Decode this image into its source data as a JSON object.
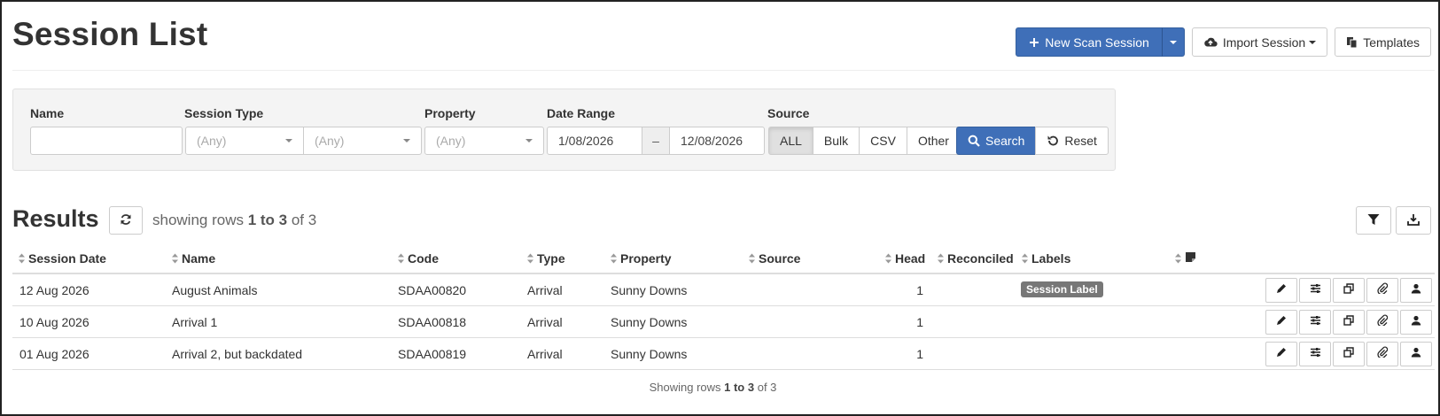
{
  "page": {
    "title": "Session List"
  },
  "header": {
    "new_session_label": "New Scan Session",
    "import_label": "Import Session",
    "templates_label": "Templates"
  },
  "filters": {
    "name_label": "Name",
    "name_value": "",
    "session_type_label": "Session Type",
    "session_type_value": "(Any)",
    "session_subtype_value": "(Any)",
    "property_label": "Property",
    "property_value": "(Any)",
    "date_range_label": "Date Range",
    "date_from": "1/08/2026",
    "date_separator": "–",
    "date_to": "12/08/2026",
    "source_label": "Source",
    "source_options": [
      "ALL",
      "Bulk",
      "CSV",
      "Other"
    ],
    "source_active": "ALL",
    "search_label": "Search",
    "reset_label": "Reset"
  },
  "results": {
    "title": "Results",
    "showing_prefix": "showing rows ",
    "showing_range": "1 to 3",
    "showing_suffix": " of 3",
    "columns": [
      "Session Date",
      "Name",
      "Code",
      "Type",
      "Property",
      "Source",
      "Head",
      "Reconciled",
      "Labels"
    ],
    "rows": [
      {
        "date": "12 Aug 2026",
        "name": "August Animals",
        "code": "SDAA00820",
        "type": "Arrival",
        "property": "Sunny Downs",
        "source": "",
        "head": "1",
        "reconciled": "",
        "label": "Session Label"
      },
      {
        "date": "10 Aug 2026",
        "name": "Arrival 1",
        "code": "SDAA00818",
        "type": "Arrival",
        "property": "Sunny Downs",
        "source": "",
        "head": "1",
        "reconciled": "",
        "label": ""
      },
      {
        "date": "01 Aug 2026",
        "name": "Arrival 2, but backdated",
        "code": "SDAA00819",
        "type": "Arrival",
        "property": "Sunny Downs",
        "source": "",
        "head": "1",
        "reconciled": "",
        "label": ""
      }
    ],
    "footer_prefix": "Showing rows ",
    "footer_range": "1 to 3",
    "footer_suffix": " of 3"
  },
  "icons": {
    "new_session": "plus-icon",
    "split": "caret-down-icon",
    "import": "cloud-upload-icon",
    "templates": "copy-files-icon",
    "search": "magnifier-icon",
    "reset": "undo-icon",
    "refresh": "refresh-icon",
    "filter": "funnel-icon",
    "download": "download-icon",
    "row_actions": [
      "pencil-icon",
      "sliders-icon",
      "duplicate-icon",
      "paperclip-icon",
      "user-icon"
    ]
  },
  "colors": {
    "primary": "#3f6fb8",
    "label_badge": "#777777"
  }
}
